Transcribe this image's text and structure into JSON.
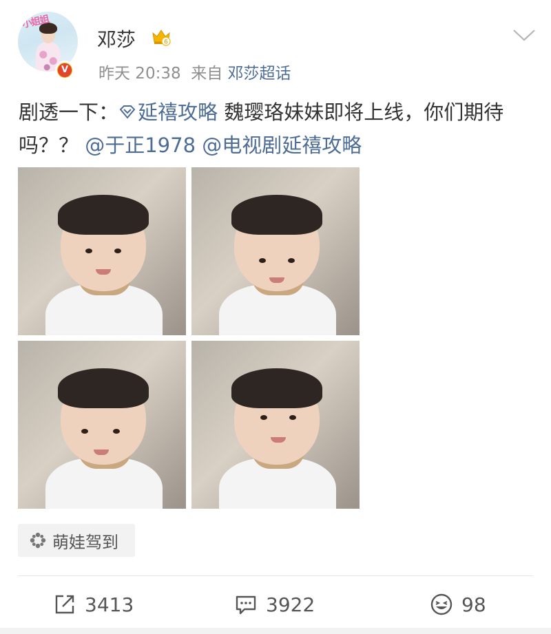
{
  "post": {
    "author": "邓莎",
    "avatar_text": "小姐姐",
    "verified_letter": "V",
    "badge_level": "6",
    "time": "昨天 20:38",
    "from_prefix": "来自",
    "source": "邓莎超话",
    "text_prefix": "剧透一下：",
    "topic": "延禧攻略",
    "text_middle": " 魏璎珞妹妹即将上线，你们期待吗？？ ",
    "mention_1": "@于正1978",
    "mention_2": "@电视剧延禧攻略",
    "tag_chip": "萌娃驾到"
  },
  "actions": {
    "share_count": "3413",
    "comment_count": "3922",
    "like_count": "98"
  },
  "icons": {
    "crown": "crown-badge-icon",
    "chevron": "chevron-down-icon",
    "topic": "diamond-topic-icon",
    "tag": "pinwheel-icon",
    "share": "share-icon",
    "comment": "comment-icon",
    "like": "smile-like-icon"
  },
  "colors": {
    "link": "#4d6c96",
    "meta_gray": "#8f8f8f",
    "verified_red": "#e3442d",
    "crown_gold": "#f4b400"
  }
}
